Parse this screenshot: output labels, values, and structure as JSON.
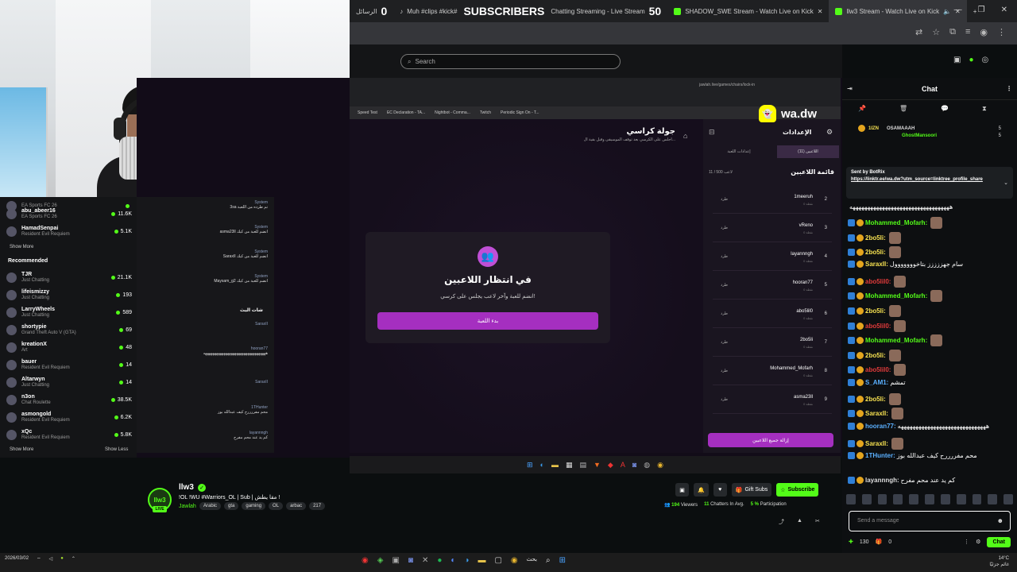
{
  "browser": {
    "overlay_left_count": "0",
    "overlay_subscribers": "SUBSCRIBERS",
    "overlay_right_count": "50",
    "tab_muh": "Muh #clips #kick#",
    "tab_chatting": "Chatting Streaming - Live Stream",
    "tab_shadow": "SHADOW_SWE Stream - Watch Live on Kick",
    "tab_active": "llw3 Stream - Watch Live on Kick",
    "tab_add": "+",
    "tab_rasail": "الرسائل"
  },
  "header": {
    "search_placeholder": "Search",
    "chat_title": "Chat"
  },
  "sidebar": {
    "top_items": [
      {
        "name": "",
        "category": "EA Sports FC 26",
        "count": ""
      },
      {
        "name": "abu_abeer16",
        "category": "EA Sports FC 26",
        "count": "11.6K"
      },
      {
        "name": "HamadSenpai",
        "category": "Resident Evil Requiem",
        "count": "5.1K"
      }
    ],
    "show_more": "Show More",
    "recommended_heading": "Recommended",
    "recommended": [
      {
        "name": "TJR",
        "category": "Just Chatting",
        "count": "21.1K"
      },
      {
        "name": "lifeismizzy",
        "category": "Just Chatting",
        "count": "193"
      },
      {
        "name": "LarryWheels",
        "category": "Just Chatting",
        "count": "589"
      },
      {
        "name": "shortypie",
        "category": "Grand Theft Auto V (GTA)",
        "count": "69"
      },
      {
        "name": "kreationX",
        "category": "Art",
        "count": "48"
      },
      {
        "name": "bauer",
        "category": "Resident Evil Requiem",
        "count": "14"
      },
      {
        "name": "Altarwyn",
        "category": "Just Chatting",
        "count": "14"
      },
      {
        "name": "n3on",
        "category": "Chat Roulette",
        "count": "38.5K"
      },
      {
        "name": "asmongold",
        "category": "Resident Evil Requiem",
        "count": "6.2K"
      },
      {
        "name": "xQc",
        "category": "Resident Evil Requiem",
        "count": "5.8K"
      }
    ],
    "show_more_2": "Show More",
    "show_less": "Show Less"
  },
  "game": {
    "title": "جولة كراسي",
    "subtitle": "اجلس على الكرسي بعد توقف الموسيقى وقبل بقية ال...",
    "waiting_title": "في انتظار اللاعبين",
    "waiting_sub": "انضم للعبة وآخر لاعب يجلس على كرسي!",
    "start_button": "بدء اللعبة",
    "settings": "الإعدادات",
    "tab_players": "اللاعبين (11)",
    "tab_settings": "إعدادات اللعبة",
    "players_title": "قائمة اللاعبين",
    "players_count": "11 / 500 لاعب",
    "kick_label": "طرد",
    "points_label": "0 نقطة",
    "players": [
      {
        "num": "2",
        "name": "1meeruh"
      },
      {
        "num": "3",
        "name": "vReno"
      },
      {
        "num": "4",
        "name": "layannngh"
      },
      {
        "num": "5",
        "name": "hooran77"
      },
      {
        "num": "6",
        "name": "abo5lil0"
      },
      {
        "num": "7",
        "name": "2bo5li"
      },
      {
        "num": "8",
        "name": "Mohammed_Mofarh"
      },
      {
        "num": "9",
        "name": "asma23ll"
      }
    ],
    "remove_all": "إزالة جميع اللاعبين",
    "url": "jawlah.live/games/chairs/lock-in"
  },
  "inner_chat": {
    "messages": [
      {
        "user": "System",
        "text": "3sa تم طرده من اللعبة"
      },
      {
        "user": "System",
        "text": "asma23ll انضم للعبة من كيك"
      },
      {
        "user": "System",
        "text": "SaraxII انضم للعبة من كيك"
      },
      {
        "user": "System",
        "text": "Maysam_g2 انضم للعبة من كيك"
      }
    ],
    "title": "شات البث",
    "lower": [
      {
        "user": "SaraxII",
        "text": ""
      },
      {
        "user": "hooran77",
        "text": "ههههههههههههههههههههههههههههههههههه"
      },
      {
        "user": "SaraxII",
        "text": ""
      },
      {
        "user": "1THunter",
        "text": "محم مفررررح كيف عبدالله بوز"
      },
      {
        "user": "layannngh",
        "text": "كم يد عند محم مفرح"
      }
    ]
  },
  "stream": {
    "avatar_text": "llw3",
    "live": "LIVE",
    "name": "llw3",
    "title": "!OL !WU  #Warriors_OL | Sub | مقا يطش !",
    "category": "Jawlah",
    "tags": [
      "Arabic",
      "gta",
      "gaming",
      "OL",
      "arbac",
      "217"
    ],
    "gift_subs": "Gift Subs",
    "subscribe": "Subscribe",
    "viewers": "194",
    "viewers_label": "Viewers",
    "chatters": "11",
    "chatters_label": "Chatters In Avg.",
    "participation": "5 %",
    "participation_label": "Participation"
  },
  "chat": {
    "gifter1_name": "OSAMAAAH",
    "gifter1_count": "5",
    "gifter2_name": "GhostMansoori",
    "gifter2_count": "5",
    "gifter_left": "1IZN",
    "pinned_by": "Sent by BotRix",
    "pinned_link": "https://linktr.ee/wa.dw?utm_source=linktree_profile_share",
    "messages": [
      {
        "user": "",
        "text": "ههههههههههههههههههههههههههههههههههه",
        "color": "white"
      },
      {
        "user": "Mohammed_Mofarh:",
        "text": "",
        "color": "green"
      },
      {
        "user": "2bo5li:",
        "text": "",
        "color": "yellow"
      },
      {
        "user": "2bo5li:",
        "text": "",
        "color": "yellow"
      },
      {
        "user": "SaraxII:",
        "text": "سام جهززززز بتاخووووووول",
        "color": "yellow"
      },
      {
        "user": "abo5lil0:",
        "text": "",
        "color": "red"
      },
      {
        "user": "Mohammed_Mofarh:",
        "text": "",
        "color": "green"
      },
      {
        "user": "2bo5li:",
        "text": "",
        "color": "yellow"
      },
      {
        "user": "abo5lil0:",
        "text": "",
        "color": "red"
      },
      {
        "user": "Mohammed_Mofarh:",
        "text": "",
        "color": "green"
      },
      {
        "user": "2bo5li:",
        "text": "",
        "color": "yellow"
      },
      {
        "user": "abo5lil0:",
        "text": "",
        "color": "red"
      },
      {
        "user": "S_AM1:",
        "text": "تمشم",
        "color": "blue"
      },
      {
        "user": "2bo5li:",
        "text": "",
        "color": "yellow"
      },
      {
        "user": "SaraxII:",
        "text": "",
        "color": "yellow"
      },
      {
        "user": "hooran77:",
        "text": "ههههههههههههههههههههههههههههههه",
        "color": "blue"
      },
      {
        "user": "SaraxII:",
        "text": "",
        "color": "yellow"
      },
      {
        "user": "1THunter:",
        "text": "محم مفررررح كيف عبدالله بوز",
        "color": "blue"
      },
      {
        "user": "layannngh:",
        "text": "كم يد عند محم مفرح",
        "color": "white"
      }
    ],
    "input_placeholder": "Send a message",
    "points": "130",
    "gift_count": "0",
    "chat_button": "Chat"
  },
  "overlay": {
    "snap_handle": "wa.dw"
  },
  "taskbar": {
    "search_label": "بحث",
    "weather": "14°C",
    "weather_sub": "غائم جزئيًا",
    "time": "04:01 ص",
    "date": "2026/03/02"
  },
  "colors": {
    "kick_green": "#53fc18",
    "game_purple": "#a52fc0",
    "background": "#0b0e0f"
  }
}
